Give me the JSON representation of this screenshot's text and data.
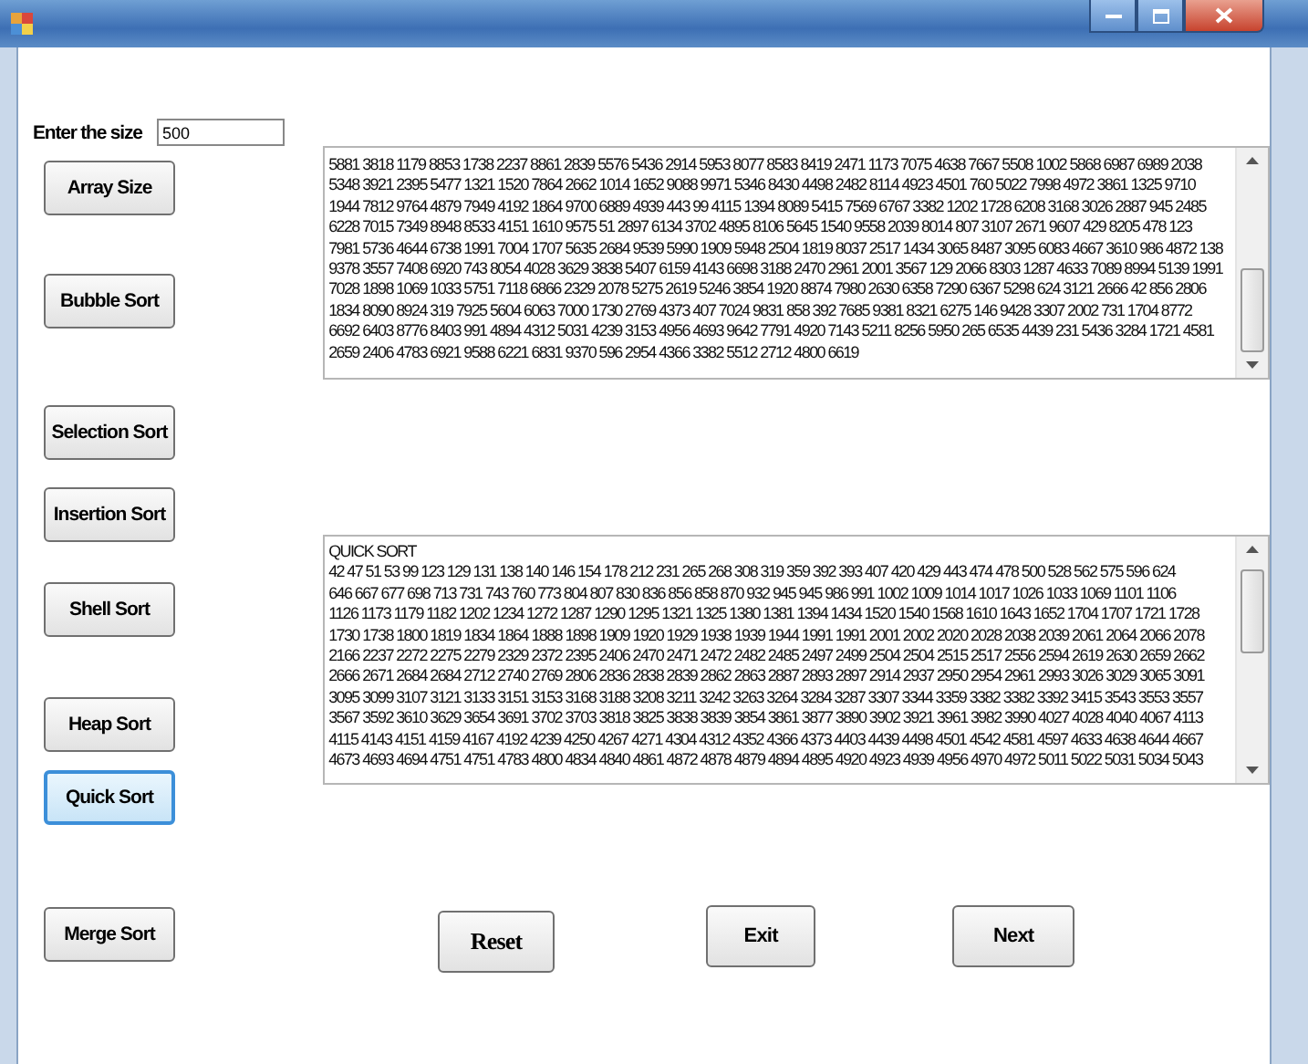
{
  "size_field": {
    "label": "Enter the size",
    "value": "500"
  },
  "sort_buttons": [
    {
      "label": "Array Size",
      "selected": false
    },
    {
      "label": "Bubble Sort",
      "selected": false
    },
    {
      "label": "Selection Sort",
      "selected": false
    },
    {
      "label": "Insertion Sort",
      "selected": false
    },
    {
      "label": "Shell Sort",
      "selected": false
    },
    {
      "label": "Heap Sort",
      "selected": false
    },
    {
      "label": "Quick Sort",
      "selected": true
    },
    {
      "label": "Merge Sort",
      "selected": false
    }
  ],
  "unsorted_output": {
    "lines": [
      "5881 3818 1179 8853 1738 2237 8861 2839 5576 5436 2914 5953 8077 8583 8419 2471 1173 7075 4638 7667 5508 1002 5868 6987 6989 2038",
      "5348 3921 2395 5477 1321 1520 7864 2662 1014 1652 9088 9971 5346 8430 4498 2482 8114 4923 4501 760 5022 7998 4972 3861 1325 9710",
      "1944 7812 9764 4879 7949 4192 1864 9700 6889 4939 443 99 4115 1394 8089 5415 7569 6767 3382 1202 1728 6208 3168 3026 2887 945 2485",
      "6228 7015 7349 8948 8533 4151 1610 9575 51 2897 6134 3702 4895 8106 5645 1540 9558 2039 8014 807 3107 2671 9607 429 8205 478 123",
      "7981 5736 4644 6738 1991 7004 1707 5635 2684 9539 5990 1909 5948 2504 1819 8037 2517 1434 3065 8487 3095 6083 4667 3610 986 4872 138",
      "9378 3557 7408 6920 743 8054 4028 3629 3838 5407 6159 4143 6698 3188 2470 2961 2001 3567 129 2066 8303 1287 4633 7089 8994 5139 1991",
      "7028 1898 1069 1033 5751 7118 6866 2329 2078 5275 2619 5246 3854 1920 8874 7980 2630 6358 7290 6367 5298 624 3121 2666 42 856 2806",
      "1834 8090 8924 319 7925 5604 6063 7000 1730 2769 4373 407 7024 9831 858 392 7685 9381 8321 6275 146 9428 3307 2002 731 1704 8772",
      "6692 6403 8776 8403 991 4894 4312 5031 4239 3153 4956 4693 9642 7791 4920 7143 5211 8256 5950 265 6535 4439 231 5436 3284 1721 4581",
      "2659 2406 4783 6921 9588 6221 6831 9370 596 2954 4366 3382 5512 2712 4800 6619"
    ]
  },
  "sorted_output": {
    "heading": "QUICK SORT",
    "lines": [
      "42 47 51 53 99 123 129 131 138 140 146 154 178 212 231 265 268 308 319 359 392 393 407 420 429 443 474 478 500 528 562 575 596 624",
      "646 667 677 698 713 731 743 760 773 804 807 830 836 856 858 870 932 945 945 986 991 1002 1009 1014 1017 1026 1033 1069 1101 1106",
      "1126 1173 1179 1182 1202 1234 1272 1287 1290 1295 1321 1325 1380 1381 1394 1434 1520 1540 1568 1610 1643 1652 1704 1707 1721 1728",
      "1730 1738 1800 1819 1834 1864 1888 1898 1909 1920 1929 1938 1939 1944 1991 1991 2001 2002 2020 2028 2038 2039 2061 2064 2066 2078",
      "2166 2237 2272 2275 2279 2329 2372 2395 2406 2470 2471 2472 2482 2485 2497 2499 2504 2504 2515 2517 2556 2594 2619 2630 2659 2662",
      "2666 2671 2684 2684 2712 2740 2769 2806 2836 2838 2839 2862 2863 2887 2893 2897 2914 2937 2950 2954 2961 2993 3026 3029 3065 3091",
      "3095 3099 3107 3121 3133 3151 3153 3168 3188 3208 3211 3242 3263 3264 3284 3287 3307 3344 3359 3382 3382 3392 3415 3543 3553 3557",
      "3567 3592 3610 3629 3654 3691 3702 3703 3818 3825 3838 3839 3854 3861 3877 3890 3902 3921 3961 3982 3990 4027 4028 4040 4067 4113",
      "4115 4143 4151 4159 4167 4192 4239 4250 4267 4271 4304 4312 4352 4366 4373 4403 4439 4498 4501 4542 4581 4597 4633 4638 4644 4667",
      "4673 4693 4694 4751 4751 4783 4800 4834 4840 4861 4872 4878 4879 4894 4895 4920 4923 4939 4956 4970 4972 5011 5022 5031 5034 5043"
    ]
  },
  "action_buttons": [
    "Reset",
    "Exit",
    "Next"
  ]
}
